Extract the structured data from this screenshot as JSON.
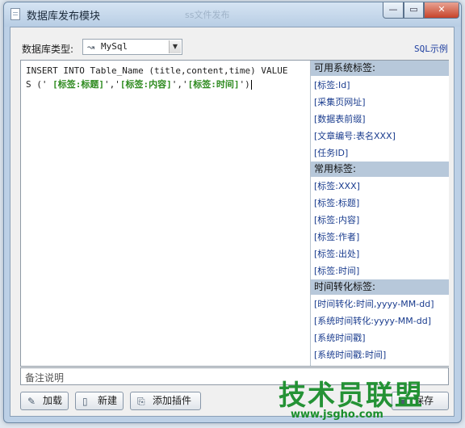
{
  "window": {
    "title": "数据库发布模块",
    "ghost_title": "ss文件发布",
    "min_label": "—",
    "max_label": "▭",
    "close_label": "✕"
  },
  "db": {
    "label": "数据库类型:",
    "selected": "MySql",
    "sql_example": "SQL示例"
  },
  "editor": {
    "parts": [
      {
        "text": "INSERT INTO Table_Name (title,content,time) VALUES (' ",
        "tag": false
      },
      {
        "text": "[标签:标题]",
        "tag": true
      },
      {
        "text": "','",
        "tag": false
      },
      {
        "text": "[标签:内容]",
        "tag": true
      },
      {
        "text": "','",
        "tag": false
      },
      {
        "text": "[标签:时间]",
        "tag": true
      },
      {
        "text": "')",
        "tag": false
      }
    ]
  },
  "tag_groups": [
    {
      "header": "可用系统标签:",
      "items": [
        "[标签:Id]",
        "[采集页网址]",
        "[数据表前缀]",
        "[文章编号:表名XXX]",
        "[任务ID]"
      ]
    },
    {
      "header": "常用标签:",
      "items": [
        "[标签:XXX]",
        "[标签:标题]",
        "[标签:内容]",
        "[标签:作者]",
        "[标签:出处]",
        "[标签:时间]"
      ]
    },
    {
      "header": "时间转化标签:",
      "items": [
        "[时间转化:时间,yyyy-MM-dd]",
        "[系统时间转化:yyyy-MM-dd]",
        "[系统时间戳]",
        "[系统时间戳:时间]"
      ]
    }
  ],
  "remark": {
    "placeholder": "备注说明"
  },
  "buttons": {
    "load": "加载",
    "new": "新建",
    "plugin": "添加插件",
    "save": "保存"
  },
  "watermark": {
    "main": "技术员联盟",
    "sub": "www.jsgho.com"
  },
  "colors": {
    "tag_green": "#2d8a1e",
    "group_header": "#b7c8da",
    "link_blue": "#1a3c8e",
    "watermark_green": "#1a8e2c"
  }
}
